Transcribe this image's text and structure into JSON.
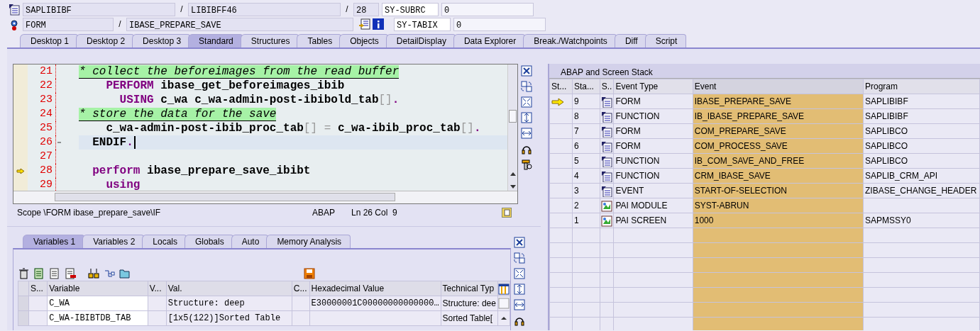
{
  "header": {
    "rows": [
      {
        "items": [
          {
            "kind": "field",
            "text": "SAPLIBIBF"
          },
          {
            "kind": "sep",
            "text": "/"
          },
          {
            "kind": "field",
            "text": "LIBIBFF46"
          },
          {
            "kind": "sep",
            "text": "/"
          },
          {
            "kind": "field",
            "text": "28"
          },
          {
            "kind": "var",
            "text": "SY-SUBRC"
          },
          {
            "kind": "value",
            "text": "0"
          }
        ]
      },
      {
        "items": [
          {
            "kind": "field",
            "text": "FORM"
          },
          {
            "kind": "sep",
            "text": "/"
          },
          {
            "kind": "field",
            "text": "IBASE_PREPARE_SAVE"
          },
          {
            "kind": "var",
            "text": "SY-TABIX"
          },
          {
            "kind": "value",
            "text": "0"
          }
        ]
      }
    ]
  },
  "tabs": [
    {
      "label": "Desktop 1",
      "selected": false
    },
    {
      "label": "Desktop 2",
      "selected": false
    },
    {
      "label": "Desktop 3",
      "selected": false
    },
    {
      "label": "Standard",
      "selected": true
    },
    {
      "label": "Structures",
      "selected": false
    },
    {
      "label": "Tables",
      "selected": false
    },
    {
      "label": "Objects",
      "selected": false
    },
    {
      "label": "DetailDisplay",
      "selected": false
    },
    {
      "label": "Data Explorer",
      "selected": false
    },
    {
      "label": "Break./Watchpoints",
      "selected": false
    },
    {
      "label": "Diff",
      "selected": false
    },
    {
      "label": "Script",
      "selected": false
    }
  ],
  "editor": {
    "lines": [
      {
        "number": "21",
        "current": false,
        "arrow": false,
        "fold": false,
        "tokens": [
          {
            "kind": "comment",
            "t": "* collect the beforeimages from the read buffer"
          }
        ]
      },
      {
        "number": "22",
        "current": false,
        "arrow": false,
        "fold": false,
        "tokens": [
          {
            "kind": "keyword",
            "t": "    PERFORM"
          },
          {
            "kind": "ident",
            "t": " ibase_get_beforeimages_ibib"
          }
        ]
      },
      {
        "number": "23",
        "current": false,
        "arrow": false,
        "fold": false,
        "tokens": [
          {
            "kind": "keyword",
            "t": "      USING"
          },
          {
            "kind": "ident",
            "t": " c_wa c_wa-admin-post-ibibold_tab"
          },
          {
            "kind": "punct",
            "t": "[]"
          },
          {
            "kind": "dot",
            "t": "."
          }
        ]
      },
      {
        "number": "24",
        "current": false,
        "arrow": false,
        "fold": false,
        "tokens": [
          {
            "kind": "comment",
            "t": "* store the data for the save"
          }
        ]
      },
      {
        "number": "25",
        "current": false,
        "arrow": false,
        "fold": false,
        "tokens": [
          {
            "kind": "ident",
            "t": "    c_wa-admin-post-ibib_proc_tab"
          },
          {
            "kind": "punct",
            "t": "[] = "
          },
          {
            "kind": "ident",
            "t": "c_wa-ibib_proc_tab"
          },
          {
            "kind": "punct",
            "t": "[]"
          },
          {
            "kind": "dot",
            "t": "."
          }
        ]
      },
      {
        "number": "26",
        "current": true,
        "arrow": false,
        "fold": true,
        "tokens": [
          {
            "kind": "ident",
            "t": "  ENDIF"
          },
          {
            "kind": "dot",
            "t": "."
          }
        ]
      },
      {
        "number": "27",
        "current": false,
        "arrow": false,
        "fold": false
      },
      {
        "number": "28",
        "current": false,
        "arrow": true,
        "fold": false,
        "tokens": [
          {
            "kind": "keyword",
            "t": "  perform"
          },
          {
            "kind": "ident",
            "t": " ibase_prepare_save_ibibt"
          }
        ]
      },
      {
        "number": "29",
        "current": false,
        "arrow": false,
        "fold": false,
        "tokens": [
          {
            "kind": "keyword",
            "t": "    using"
          }
        ]
      }
    ],
    "status": {
      "scope": "Scope \\FORM ibase_prepare_save\\IF",
      "language": "ABAP",
      "position": "Ln 26 Col  9"
    }
  },
  "stack": {
    "title": "ABAP and Screen Stack",
    "columns": [
      "St...",
      "Sta...",
      "S..",
      "Event Type",
      "Event",
      "Program"
    ],
    "rows": [
      {
        "current": true,
        "level": "9",
        "kind": "abap",
        "event_type": "FORM",
        "event": "IBASE_PREPARE_SAVE",
        "program": "SAPLIBIBF"
      },
      {
        "current": false,
        "level": "8",
        "kind": "abap",
        "event_type": "FUNCTION",
        "event": "IB_IBASE_PREPARE_SAVE",
        "program": "SAPLIBIBF"
      },
      {
        "current": false,
        "level": "7",
        "kind": "abap",
        "event_type": "FORM",
        "event": "COM_PREPARE_SAVE",
        "program": "SAPLIBCO"
      },
      {
        "current": false,
        "level": "6",
        "kind": "abap",
        "event_type": "FORM",
        "event": "COM_PROCESS_SAVE",
        "program": "SAPLIBCO"
      },
      {
        "current": false,
        "level": "5",
        "kind": "abap",
        "event_type": "FUNCTION",
        "event": "IB_COM_SAVE_AND_FREE",
        "program": "SAPLIBCO"
      },
      {
        "current": false,
        "level": "4",
        "kind": "abap",
        "event_type": "FUNCTION",
        "event": "CRM_IBASE_SAVE",
        "program": "SAPLIB_CRM_API"
      },
      {
        "current": false,
        "level": "3",
        "kind": "abap",
        "event_type": "EVENT",
        "event": "START-OF-SELECTION",
        "program": "ZIBASE_CHANGE_HEADER"
      },
      {
        "current": false,
        "level": "2",
        "kind": "screen",
        "event_type": "PAI MODULE",
        "event": "SYST-ABRUN"
      },
      {
        "current": false,
        "level": "1",
        "kind": "screen",
        "event_type": "PAI SCREEN",
        "event": "1000",
        "program": "SAPMSSY0"
      }
    ]
  },
  "variables": {
    "tabs": [
      {
        "label": "Variables 1",
        "selected": true
      },
      {
        "label": "Variables 2",
        "selected": false
      },
      {
        "label": "Locals",
        "selected": false
      },
      {
        "label": "Globals",
        "selected": false
      },
      {
        "label": "Auto",
        "selected": false
      },
      {
        "label": "Memory Analysis",
        "selected": false
      }
    ],
    "columns": [
      "S...",
      "Variable",
      "V...",
      "Val.",
      "C...",
      "Hexadecimal Value",
      "Technical Typ"
    ],
    "rows": [
      {
        "variable": "C_WA",
        "value": "Structure: deep",
        "hex": "E30000001C00000000000000…",
        "type": "Structure: dee"
      },
      {
        "variable": "C_WA-IBIBTDB_TAB",
        "value": "[1x5(122)]Sorted Table",
        "type": "Sorted Table["
      }
    ]
  }
}
